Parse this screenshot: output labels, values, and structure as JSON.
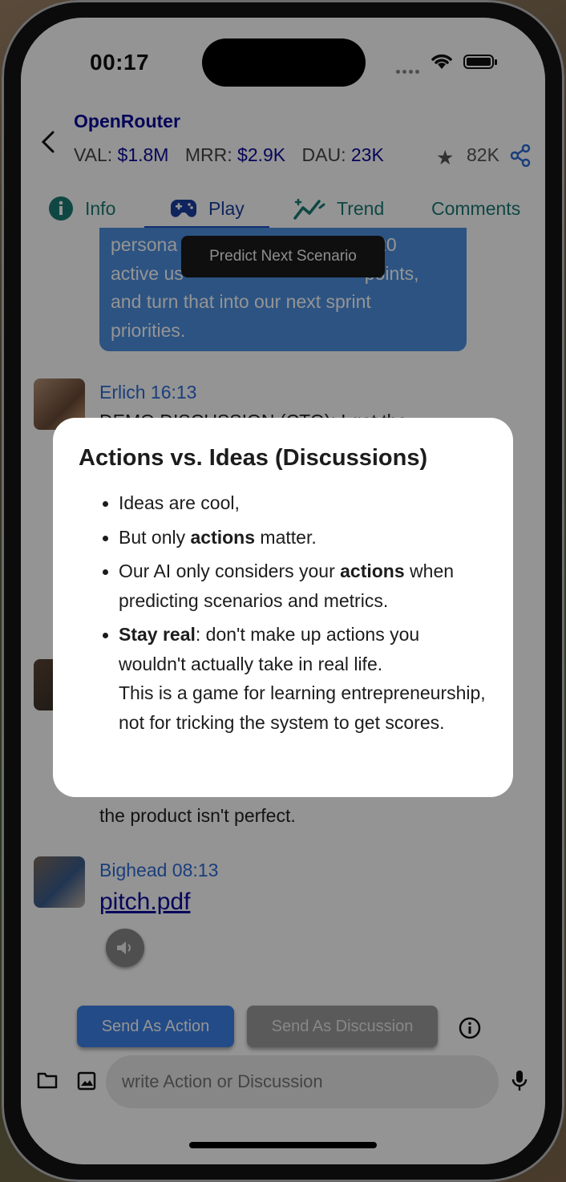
{
  "status_bar": {
    "time": "00:17"
  },
  "header": {
    "app_name": "OpenRouter",
    "metrics": [
      {
        "label": "VAL:",
        "value": "$1.8M"
      },
      {
        "label": "MRR:",
        "value": "$2.9K"
      },
      {
        "label": "DAU:",
        "value": "23K"
      }
    ],
    "stars": "82K"
  },
  "tabs": [
    {
      "label": "Info",
      "icon": "info-icon"
    },
    {
      "label": "Play",
      "icon": "gamepad-icon",
      "active": true
    },
    {
      "label": "Trend",
      "icon": "trend-icon"
    },
    {
      "label": "Comments"
    }
  ],
  "tooltip": "Predict Next Scenario",
  "messages": {
    "bubble_lines": [
      "persona",
      "20",
      "active us",
      "points,",
      "and turn that into our next sprint",
      "priorities."
    ],
    "erlich": {
      "name": "Erlich 16:13",
      "partial_text": "DEMO DISCUSSION (CTO): I got the"
    },
    "mid": {
      "text_tail": "the product isn't perfect."
    },
    "bighead": {
      "name": "Bighead 08:13",
      "attachment": "pitch.pdf"
    }
  },
  "buttons": {
    "send_action": "Send As Action",
    "send_discussion": "Send As Discussion"
  },
  "input": {
    "placeholder": "write Action or Discussion"
  },
  "dialog": {
    "title": "Actions vs. Ideas (Discussions)",
    "b1": "Ideas are cool,",
    "b2_pre": "But only ",
    "b2_bold": "actions",
    "b2_post": " matter.",
    "b3_pre": "Our AI only considers your ",
    "b3_bold": "actions",
    "b3_post": " when predicting scenarios and metrics.",
    "b4_bold": "Stay real",
    "b4_l1": ": don't make up actions you wouldn't actually take in real life.",
    "b4_l2": "This is a game for learning entrepreneurship,",
    "b4_l3": "not for tricking the system to get scores."
  },
  "colors": {
    "accent_blue": "#3d82e8",
    "teal": "#1a7a74",
    "navy": "#0a0a9a"
  }
}
